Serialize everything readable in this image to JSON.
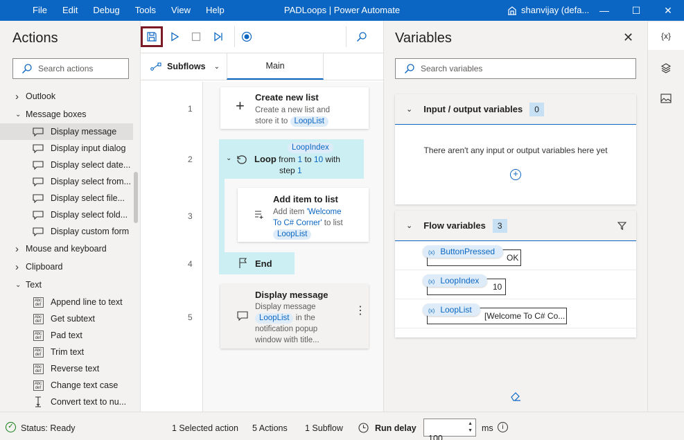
{
  "titlebar": {
    "menu": [
      "File",
      "Edit",
      "Debug",
      "Tools",
      "View",
      "Help"
    ],
    "title": "PADLoops | Power Automate",
    "user": "shanvijay (defa..."
  },
  "actions": {
    "title": "Actions",
    "search_placeholder": "Search actions",
    "tree": [
      {
        "type": "group",
        "label": "Outlook",
        "expanded": false
      },
      {
        "type": "group",
        "label": "Message boxes",
        "expanded": true
      },
      {
        "type": "item",
        "label": "Display message",
        "icon": "message-box-icon",
        "selected": true
      },
      {
        "type": "item",
        "label": "Display input dialog",
        "icon": "message-box-icon"
      },
      {
        "type": "item",
        "label": "Display select date...",
        "icon": "message-box-icon"
      },
      {
        "type": "item",
        "label": "Display select from...",
        "icon": "message-box-icon"
      },
      {
        "type": "item",
        "label": "Display select file...",
        "icon": "message-box-icon"
      },
      {
        "type": "item",
        "label": "Display select fold...",
        "icon": "message-box-icon"
      },
      {
        "type": "item",
        "label": "Display custom form",
        "icon": "message-box-icon"
      },
      {
        "type": "group",
        "label": "Mouse and keyboard",
        "expanded": false
      },
      {
        "type": "group",
        "label": "Clipboard",
        "expanded": false
      },
      {
        "type": "group",
        "label": "Text",
        "expanded": true
      },
      {
        "type": "item",
        "label": "Append line to text",
        "icon": "text-icon"
      },
      {
        "type": "item",
        "label": "Get subtext",
        "icon": "text-icon"
      },
      {
        "type": "item",
        "label": "Pad text",
        "icon": "text-icon"
      },
      {
        "type": "item",
        "label": "Trim text",
        "icon": "text-icon"
      },
      {
        "type": "item",
        "label": "Reverse text",
        "icon": "text-icon"
      },
      {
        "type": "item",
        "label": "Change text case",
        "icon": "text-icon"
      },
      {
        "type": "item",
        "label": "Convert text to nu...",
        "icon": "convert-icon"
      }
    ]
  },
  "designer": {
    "subflows_label": "Subflows",
    "main_tab": "Main",
    "line_numbers": [
      "1",
      "2",
      "3",
      "4",
      "5"
    ],
    "steps": {
      "s1": {
        "title": "Create new list",
        "desc1": "Create a new list and",
        "desc2": "store it to",
        "var": "LoopList"
      },
      "s2": {
        "var_top": "LoopIndex",
        "title": "Loop",
        "from_word": "from",
        "from": "1",
        "to_word": "to",
        "to": "10",
        "with_word": "with",
        "step_word": "step",
        "step": "1"
      },
      "s3": {
        "title": "Add item to list",
        "desc1": "Add item",
        "value1": "'Welcome",
        "value2": "To C# Corner'",
        "to_list": "to list",
        "var": "LoopList"
      },
      "s4": {
        "title": "End"
      },
      "s5": {
        "title": "Display message",
        "desc1": "Display message",
        "var": "LoopList",
        "desc2": "in the",
        "desc3": "notification popup",
        "desc4": "window with title..."
      }
    }
  },
  "variables": {
    "title": "Variables",
    "search_placeholder": "Search variables",
    "io": {
      "title": "Input / output variables",
      "count": "0",
      "empty": "There aren't any input or output variables here yet"
    },
    "flow": {
      "title": "Flow variables",
      "count": "3",
      "items": [
        {
          "name": "ButtonPressed",
          "value": "OK"
        },
        {
          "name": "LoopIndex",
          "value": "10"
        },
        {
          "name": "LoopList",
          "value": "[Welcome To C# Co..."
        }
      ]
    },
    "var_prefix": "(x)"
  },
  "rail": {
    "variables_icon": "{x}"
  },
  "status": {
    "state": "Status: Ready",
    "selected": "1 Selected action",
    "actions": "5 Actions",
    "subflow": "1 Subflow",
    "run_delay": "Run delay",
    "delay_value": "100",
    "unit": "ms"
  },
  "colors": {
    "accent": "#0a66c2",
    "loop_bg": "#cbeff3",
    "save_highlight": "#7b1a24"
  }
}
